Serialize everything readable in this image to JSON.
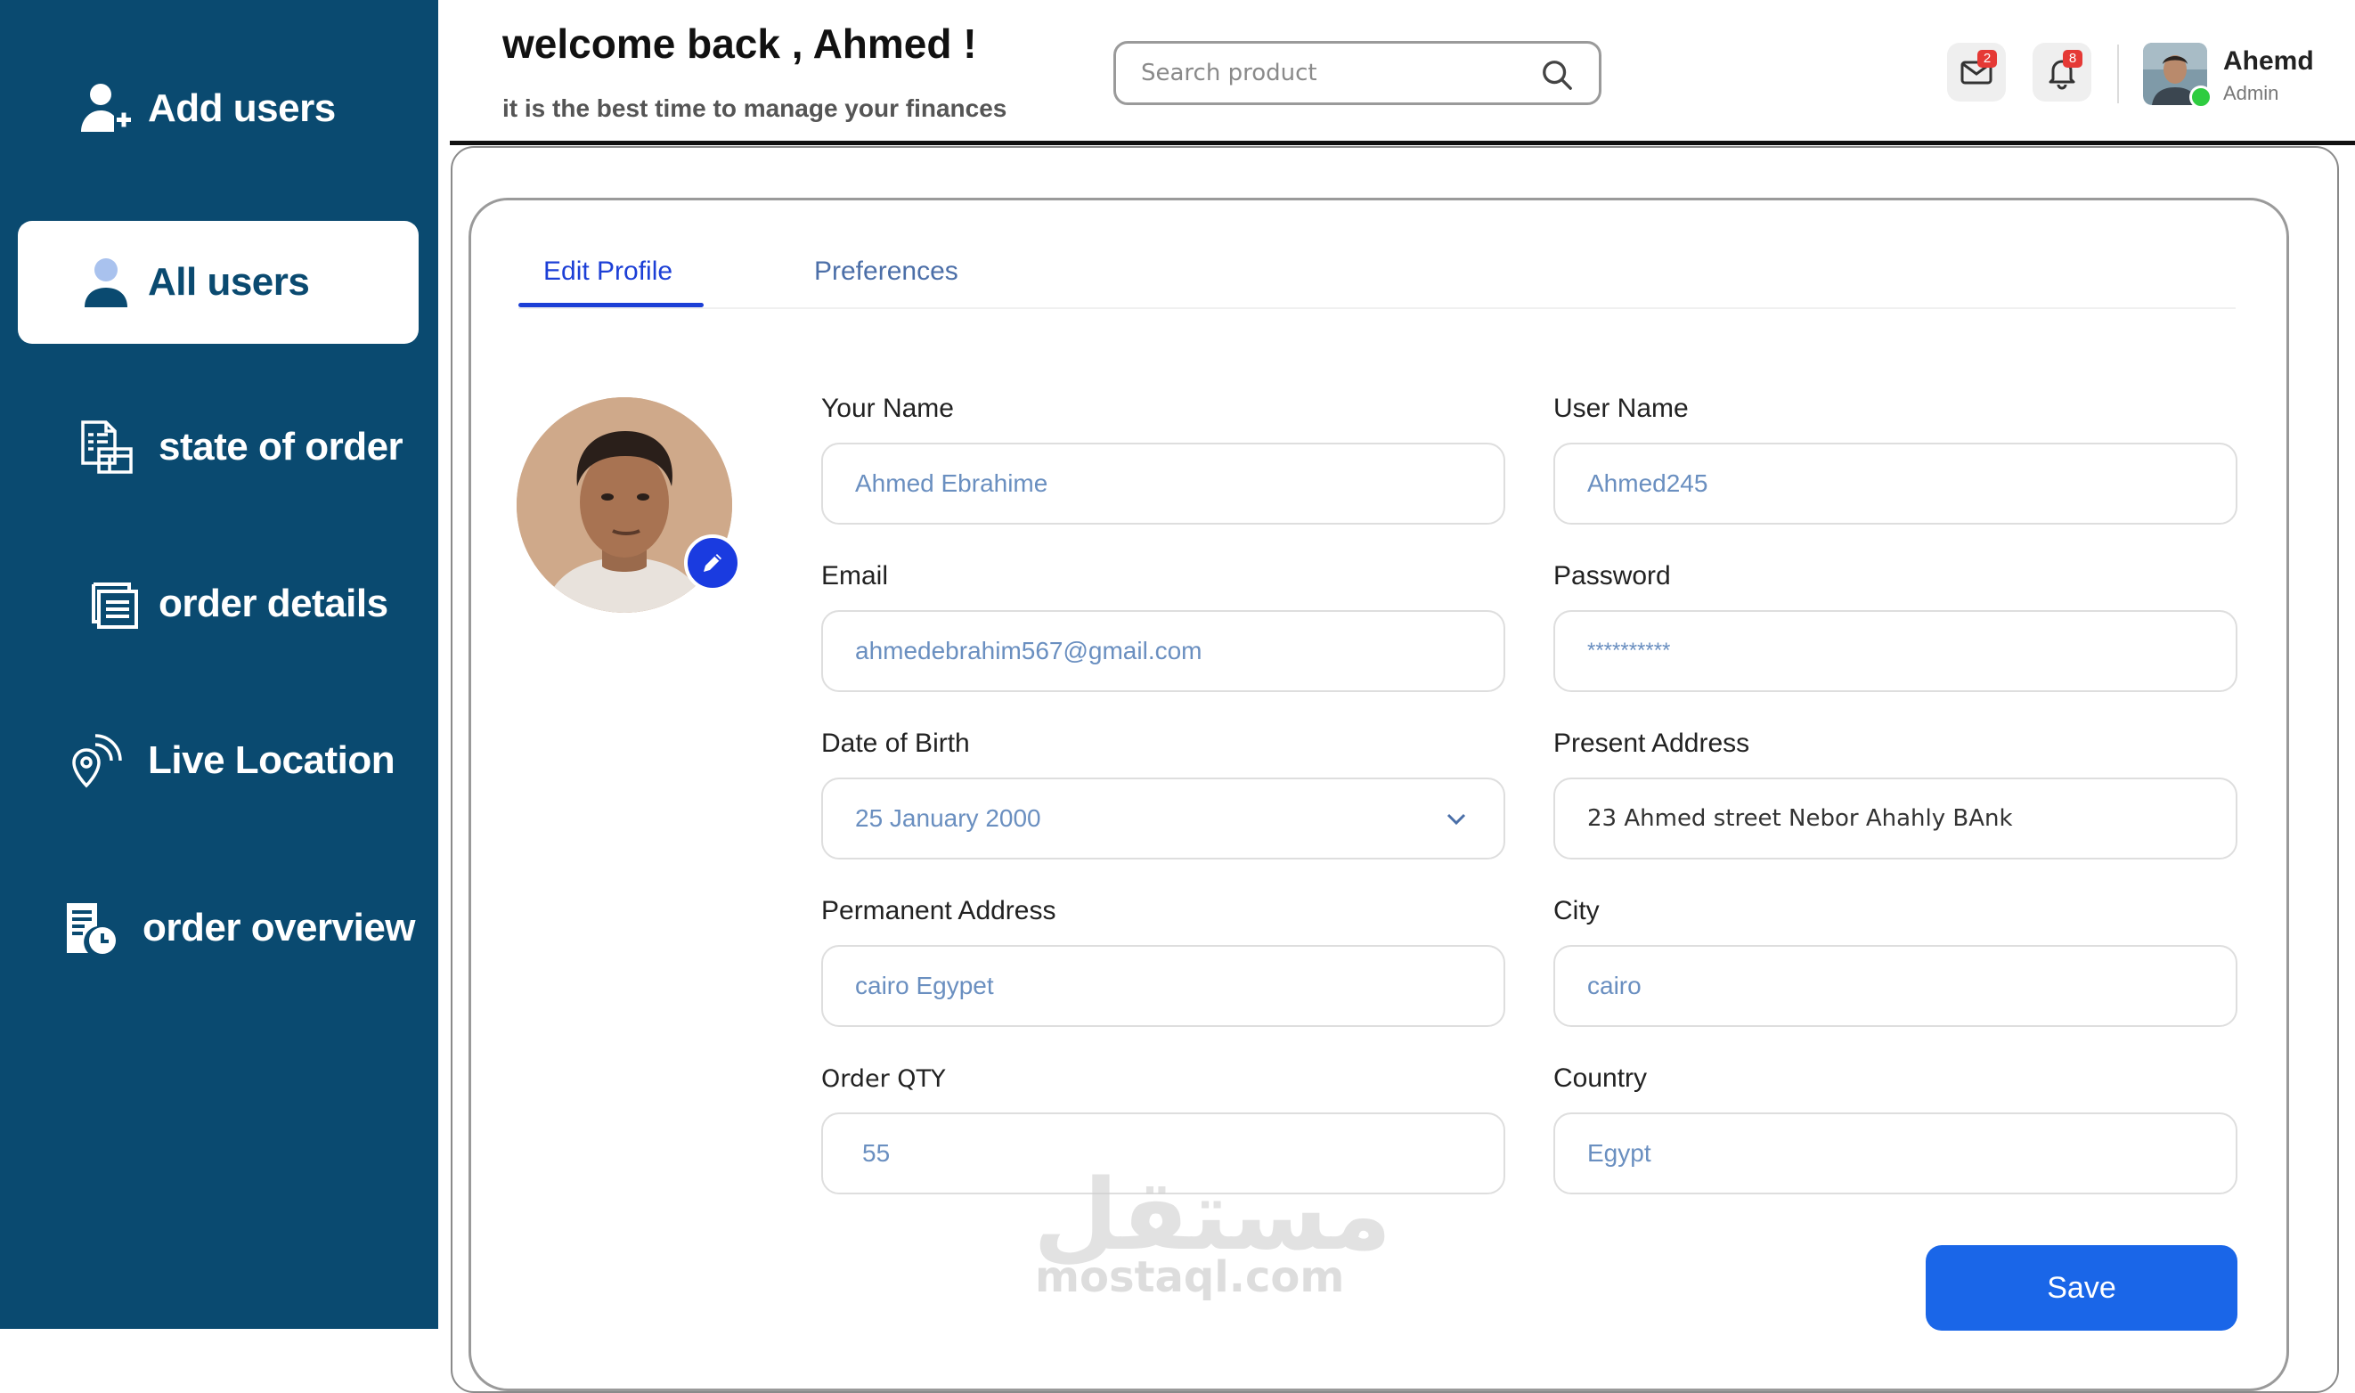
{
  "sidebar": {
    "items": [
      {
        "label": "Add users",
        "icon": "add-user-icon"
      },
      {
        "label": "All users",
        "icon": "user-icon",
        "active": true
      },
      {
        "label": "state of order",
        "icon": "document-list-icon"
      },
      {
        "label": "order details",
        "icon": "stacked-document-icon"
      },
      {
        "label": "Live Location",
        "icon": "location-signal-icon"
      },
      {
        "label": "order overview",
        "icon": "clipboard-clock-icon"
      }
    ]
  },
  "header": {
    "welcome": "welcome back , Ahmed !",
    "subtitle": "it is the best time to manage your finances",
    "search_placeholder": "Search product",
    "mail_count": "2",
    "notification_count": "8",
    "user_name": "Ahemd",
    "user_role": "Admin"
  },
  "tabs": [
    {
      "label": "Edit Profile",
      "active": true
    },
    {
      "label": "Preferences",
      "active": false
    }
  ],
  "form": {
    "your_name": {
      "label": "Your Name",
      "value": "Ahmed Ebrahime"
    },
    "user_name": {
      "label": "User Name",
      "value": "Ahmed245"
    },
    "email": {
      "label": "Email",
      "value": "ahmedebrahim567@gmail.com"
    },
    "password": {
      "label": "Password",
      "value": "**********"
    },
    "dob": {
      "label": "Date of Birth",
      "value": "25 January 2000"
    },
    "present_address": {
      "label": "Present Address",
      "value": "23 Ahmed street Nebor Ahahly BAnk"
    },
    "permanent_address": {
      "label": "Permanent Address",
      "value": "cairo Egypet"
    },
    "city": {
      "label": "City",
      "value": "cairo"
    },
    "order_qty": {
      "label": "Order QTY",
      "value": "55"
    },
    "country": {
      "label": "Country",
      "value": "Egypt"
    }
  },
  "save_label": "Save",
  "watermark": {
    "arabic": "مستقل",
    "latin": "mostaql.com"
  },
  "colors": {
    "sidebar": "#0a4a70",
    "accent": "#1c3fd6",
    "save_button": "#1a66e8",
    "badge": "#e53935",
    "field_text": "#6a8fc0"
  }
}
